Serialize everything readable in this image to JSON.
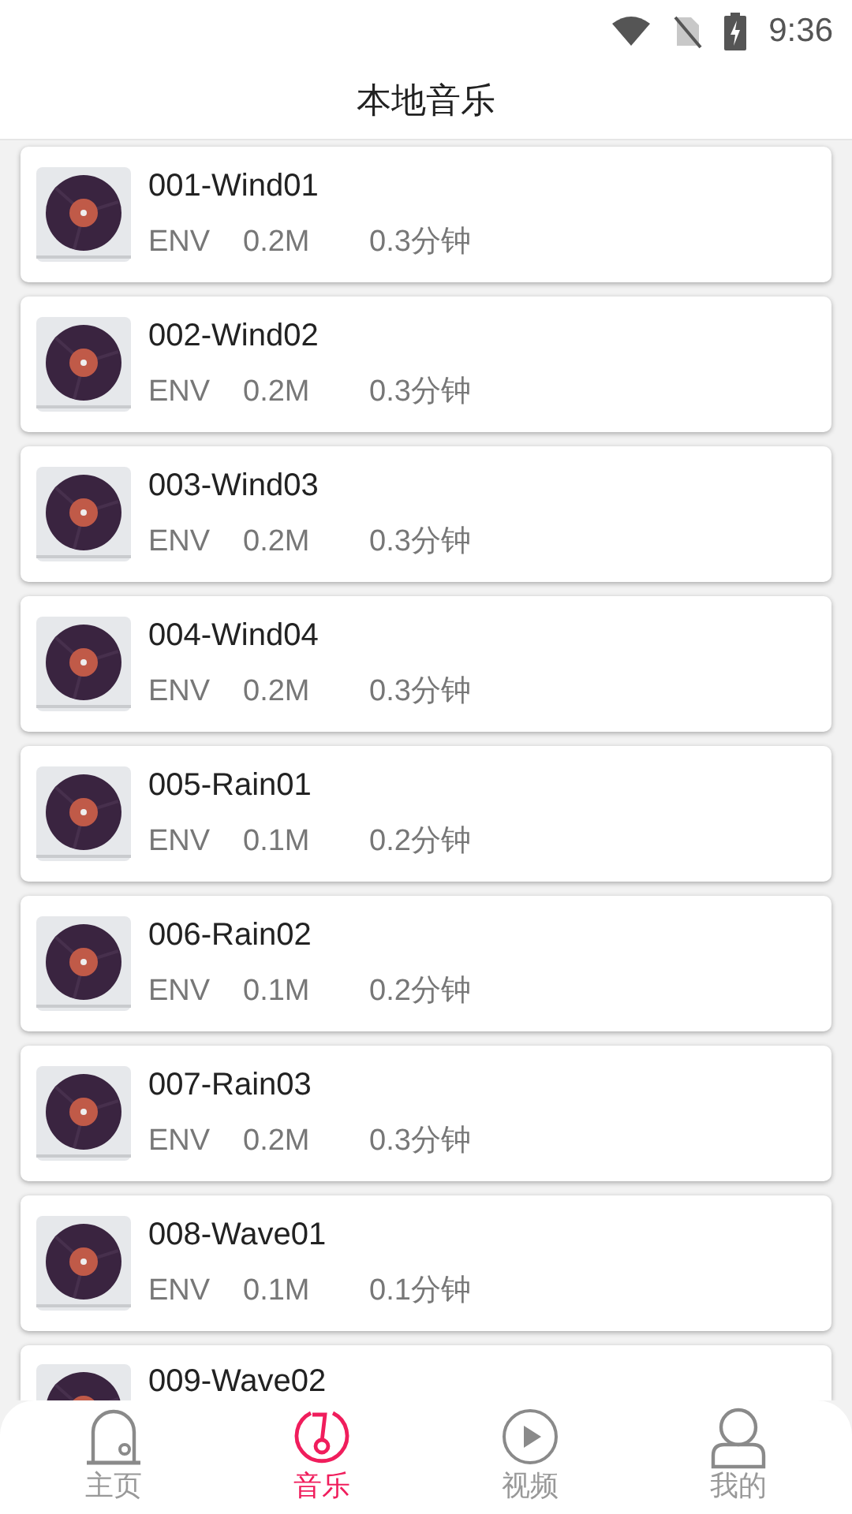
{
  "status_bar": {
    "time": "9:36"
  },
  "header": {
    "title": "本地音乐"
  },
  "tracks": [
    {
      "title": "001-Wind01",
      "type": "ENV",
      "size": "0.2M",
      "duration": "0.3分钟"
    },
    {
      "title": "002-Wind02",
      "type": "ENV",
      "size": "0.2M",
      "duration": "0.3分钟"
    },
    {
      "title": "003-Wind03",
      "type": "ENV",
      "size": "0.2M",
      "duration": "0.3分钟"
    },
    {
      "title": "004-Wind04",
      "type": "ENV",
      "size": "0.2M",
      "duration": "0.3分钟"
    },
    {
      "title": "005-Rain01",
      "type": "ENV",
      "size": "0.1M",
      "duration": "0.2分钟"
    },
    {
      "title": "006-Rain02",
      "type": "ENV",
      "size": "0.1M",
      "duration": "0.2分钟"
    },
    {
      "title": "007-Rain03",
      "type": "ENV",
      "size": "0.2M",
      "duration": "0.3分钟"
    },
    {
      "title": "008-Wave01",
      "type": "ENV",
      "size": "0.1M",
      "duration": "0.1分钟"
    },
    {
      "title": "009-Wave02"
    }
  ],
  "bottom_nav": [
    {
      "kind": "home",
      "label": "主页",
      "selected": false
    },
    {
      "kind": "music",
      "label": "音乐",
      "selected": true
    },
    {
      "kind": "video",
      "label": "视频",
      "selected": false
    },
    {
      "kind": "profile",
      "label": "我的",
      "selected": false
    }
  ]
}
